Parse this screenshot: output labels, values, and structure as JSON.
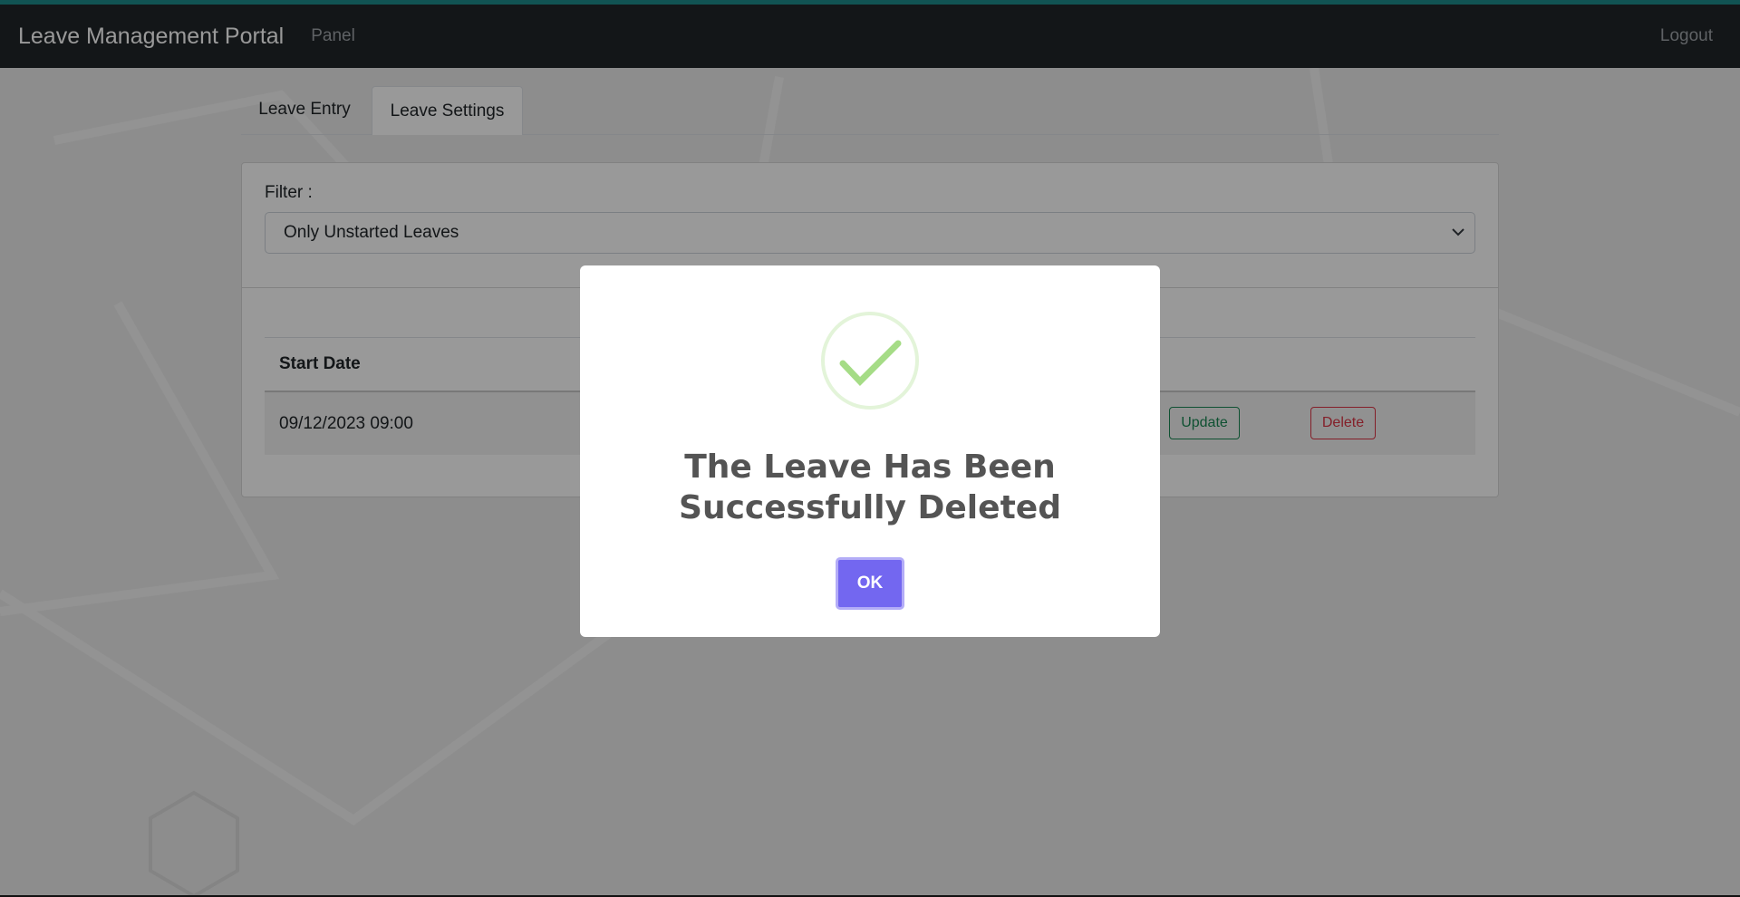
{
  "navbar": {
    "brand": "Leave Management Portal",
    "panel_link": "Panel",
    "logout_link": "Logout"
  },
  "tabs": [
    {
      "label": "Leave Entry"
    },
    {
      "label": "Leave Settings"
    }
  ],
  "filter": {
    "label": "Filter :",
    "selected": "Only Unstarted Leaves"
  },
  "table": {
    "headers": [
      "Start Date"
    ],
    "rows": [
      {
        "start_date": "09/12/2023 09:00",
        "update_label": "Update",
        "delete_label": "Delete"
      }
    ]
  },
  "modal": {
    "icon": "success-check-icon",
    "title": "The Leave Has Been Successfully Deleted",
    "ok_label": "OK"
  },
  "colors": {
    "navbar_bg": "#212529",
    "accent": "#7367f0",
    "success": "#198754",
    "danger": "#dc3545",
    "check_green": "#a5dc86"
  }
}
